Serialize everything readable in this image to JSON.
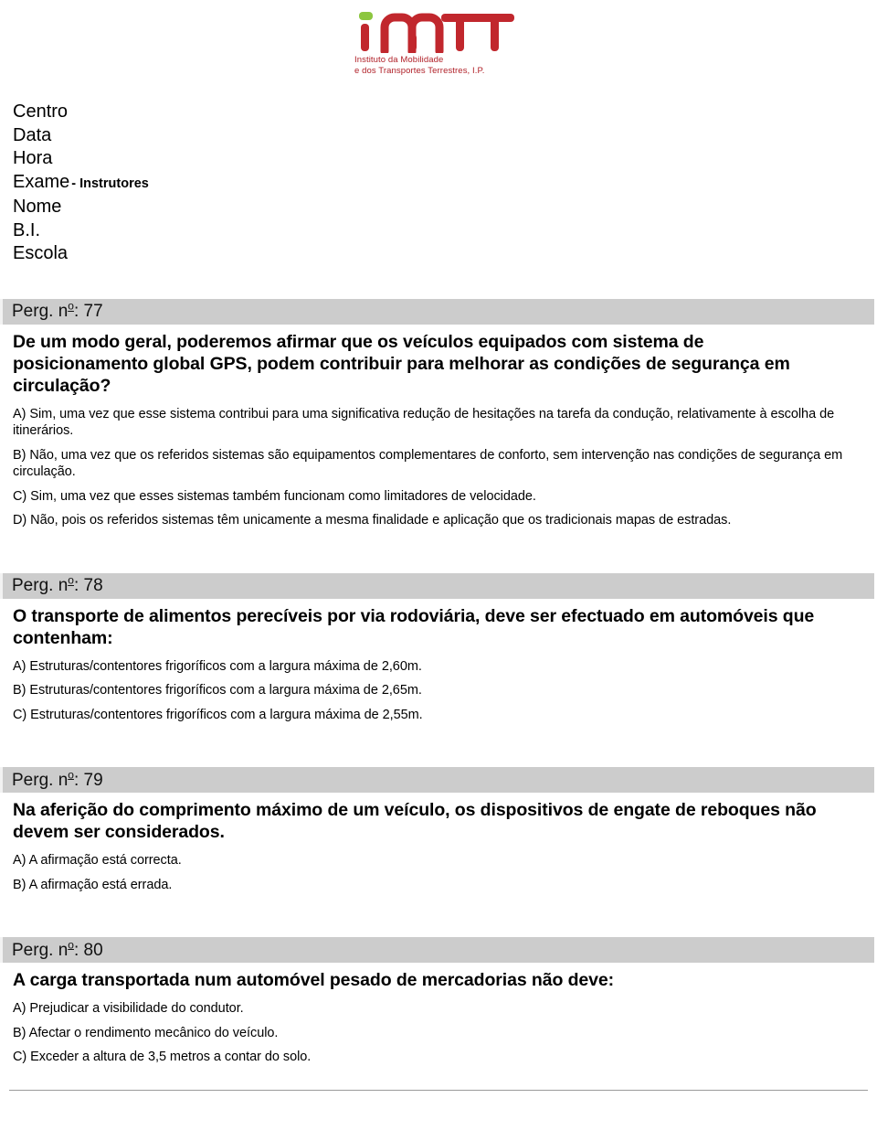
{
  "logo": {
    "wordmark": "imtt",
    "subtitle_line1": "Instituto da Mobilidade",
    "subtitle_line2": "e dos Transportes Terrestres, I.P.",
    "red": "#c1272d",
    "green": "#8cc63f"
  },
  "header": {
    "fields": [
      {
        "label": "Centro",
        "suffix": ""
      },
      {
        "label": "Data",
        "suffix": ""
      },
      {
        "label": "Hora",
        "suffix": ""
      },
      {
        "label": "Exame",
        "suffix": "- Instrutores"
      },
      {
        "label": "Nome",
        "suffix": ""
      },
      {
        "label": "B.I.",
        "suffix": ""
      },
      {
        "label": "Escola",
        "suffix": ""
      }
    ]
  },
  "questions": [
    {
      "bar_prefix": "Perg. n",
      "bar_ordinal": "o",
      "bar_suffix": ": 77",
      "text": "De um modo geral, poderemos afirmar que os veículos equipados com sistema de posicionamento global GPS, podem contribuir para melhorar as condições de segurança em circulação?",
      "answers": [
        "A) Sim, uma vez que esse sistema contribui para uma significativa redução de hesitações na tarefa da condução, relativamente à escolha de itinerários.",
        "B) Não, uma vez que os referidos sistemas são equipamentos complementares de conforto, sem intervenção nas condições de segurança em circulação.",
        "C) Sim, uma vez que esses sistemas também funcionam como limitadores de velocidade.",
        "D) Não, pois os referidos sistemas têm unicamente a mesma finalidade e aplicação que os tradicionais mapas de estradas."
      ]
    },
    {
      "bar_prefix": "Perg. n",
      "bar_ordinal": "o",
      "bar_suffix": ": 78",
      "text": "O transporte de alimentos perecíveis por via rodoviária, deve ser efectuado em automóveis que contenham:",
      "answers": [
        "A) Estruturas/contentores frigoríficos com a largura máxima de 2,60m.",
        "B) Estruturas/contentores frigoríficos com a largura máxima de 2,65m.",
        "C) Estruturas/contentores frigoríficos com a largura máxima de 2,55m."
      ]
    },
    {
      "bar_prefix": "Perg. n",
      "bar_ordinal": "o",
      "bar_suffix": ": 79",
      "text": "Na aferição do comprimento máximo de um veículo, os dispositivos de engate de reboques não devem ser considerados.",
      "answers": [
        "A) A afirmação está correcta.",
        "B) A afirmação está errada."
      ]
    },
    {
      "bar_prefix": "Perg. n",
      "bar_ordinal": "o",
      "bar_suffix": ": 80",
      "text": "A carga transportada num automóvel pesado de mercadorias não deve:",
      "answers": [
        "A) Prejudicar a visibilidade do condutor.",
        "B) Afectar o rendimento mecânico do veículo.",
        "C) Exceder a altura de 3,5 metros a contar do solo."
      ]
    }
  ]
}
